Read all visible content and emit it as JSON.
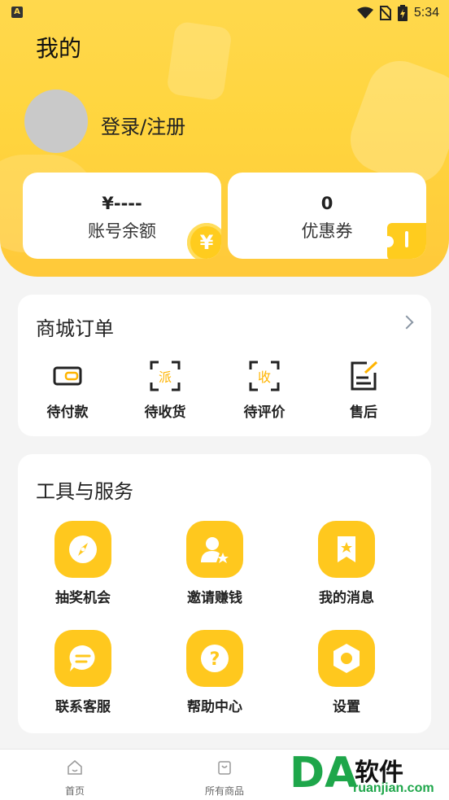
{
  "status_bar": {
    "time": "5:34",
    "app_badge": "A"
  },
  "header": {
    "title": "我的"
  },
  "profile": {
    "login_label": "登录/注册"
  },
  "balance_card": {
    "value": "¥----",
    "label": "账号余额",
    "coin_symbol": "¥"
  },
  "coupon_card": {
    "value": "0",
    "label": "优惠券"
  },
  "orders": {
    "title": "商城订单",
    "items": [
      {
        "label": "待付款",
        "icon": "wallet-icon"
      },
      {
        "label": "待收货",
        "icon": "dispatch-icon",
        "glyph": "派"
      },
      {
        "label": "待评价",
        "icon": "receive-icon",
        "glyph": "收"
      },
      {
        "label": "售后",
        "icon": "edit-note-icon"
      }
    ]
  },
  "tools": {
    "title": "工具与服务",
    "items": [
      {
        "label": "抽奖机会",
        "icon": "compass-icon"
      },
      {
        "label": "邀请赚钱",
        "icon": "invite-user-icon"
      },
      {
        "label": "我的消息",
        "icon": "bookmark-star-icon"
      },
      {
        "label": "联系客服",
        "icon": "chat-icon"
      },
      {
        "label": "帮助中心",
        "icon": "help-icon",
        "glyph": "?"
      },
      {
        "label": "设置",
        "icon": "settings-icon"
      }
    ]
  },
  "bottom_nav": [
    {
      "label": "首页",
      "icon": "home-icon"
    },
    {
      "label": "所有商品",
      "icon": "bag-icon"
    }
  ],
  "watermark": {
    "brand": "软件",
    "url": "ruanjian.com"
  },
  "colors": {
    "accent": "#ffc81e",
    "header": "#ffd84d"
  }
}
